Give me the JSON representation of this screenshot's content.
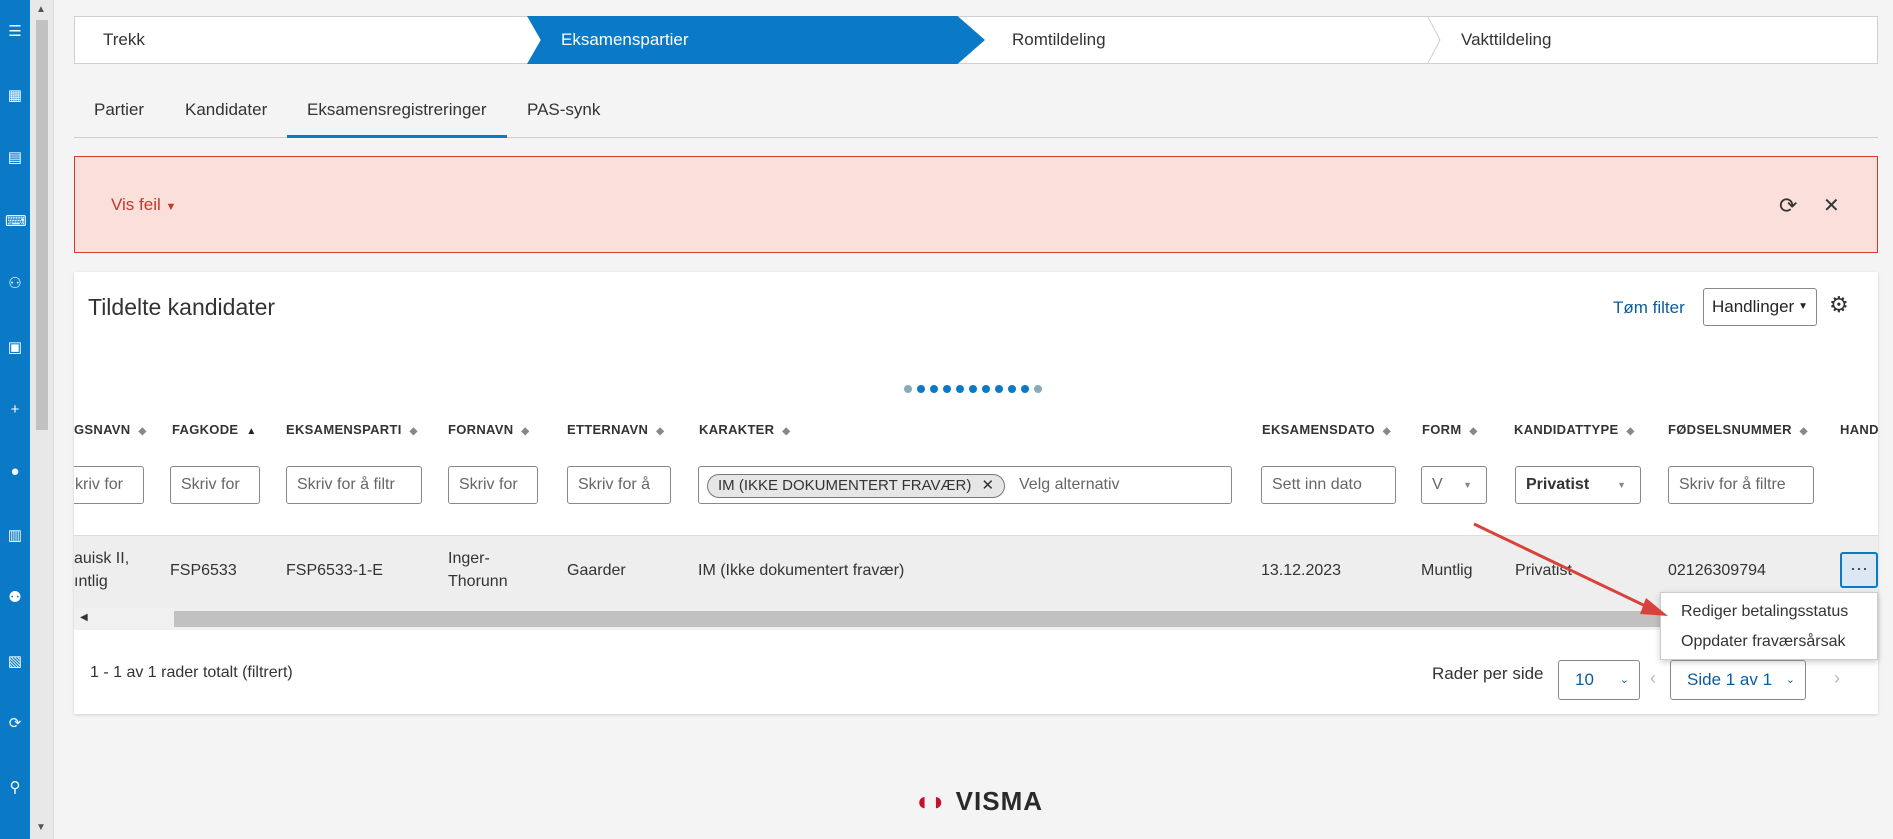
{
  "wizard": {
    "steps": [
      "Trekk",
      "Eksamenspartier",
      "Romtildeling",
      "Vakttildeling"
    ]
  },
  "tabs": [
    "Partier",
    "Kandidater",
    "Eksamensregistreringer",
    "PAS-synk"
  ],
  "error": {
    "label": "Vis feil"
  },
  "card": {
    "title": "Tildelte kandidater",
    "clear_filter": "Tøm filter",
    "actions": "Handlinger"
  },
  "columns": [
    "GSNAVN",
    "FAGKODE",
    "EKSAMENSPARTI",
    "FORNAVN",
    "ETTERNAVN",
    "KARAKTER",
    "EKSAMENSDATO",
    "FORM",
    "KANDIDATTYPE",
    "FØDSELSNUMMER",
    "HAND"
  ],
  "filters": {
    "c0": "kriv for",
    "c1": "Skriv for",
    "c2": "Skriv for å filtr",
    "c3": "Skriv for",
    "c4": "Skriv for å",
    "karakter_tag": "IM (IKKE DOKUMENTERT FRAVÆR)",
    "karakter_placeholder": "Velg alternativ",
    "dato": "Sett inn dato",
    "form": "V",
    "kandidattype": "Privatist",
    "fodsel": "Skriv for å filtre"
  },
  "row": {
    "c0a": "auisk II,",
    "c0b": "ıntlig",
    "fagkode": "FSP6533",
    "parti": "FSP6533-1-E",
    "fornavn_a": "Inger-",
    "fornavn_b": "Thorunn",
    "etternavn": "Gaarder",
    "karakter": "IM (Ikke dokumentert fravær)",
    "dato": "13.12.2023",
    "form": "Muntlig",
    "kandidattype": "Privatist",
    "fodsel": "02126309794",
    "more": "···"
  },
  "menu": [
    "Rediger betalingsstatus",
    "Oppdater fraværsårsak"
  ],
  "footer": {
    "count": "1 - 1 av 1 rader totalt (filtrert)",
    "rows_per_page_label": "Rader per side",
    "rows_per_page": "10",
    "page": "Side 1 av 1"
  },
  "brand": "VISMA",
  "colors": {
    "primary": "#0a7ac7",
    "error_bg": "#fadfdb",
    "error_border": "#d63a2a",
    "annotation_arrow": "#d9423a"
  }
}
